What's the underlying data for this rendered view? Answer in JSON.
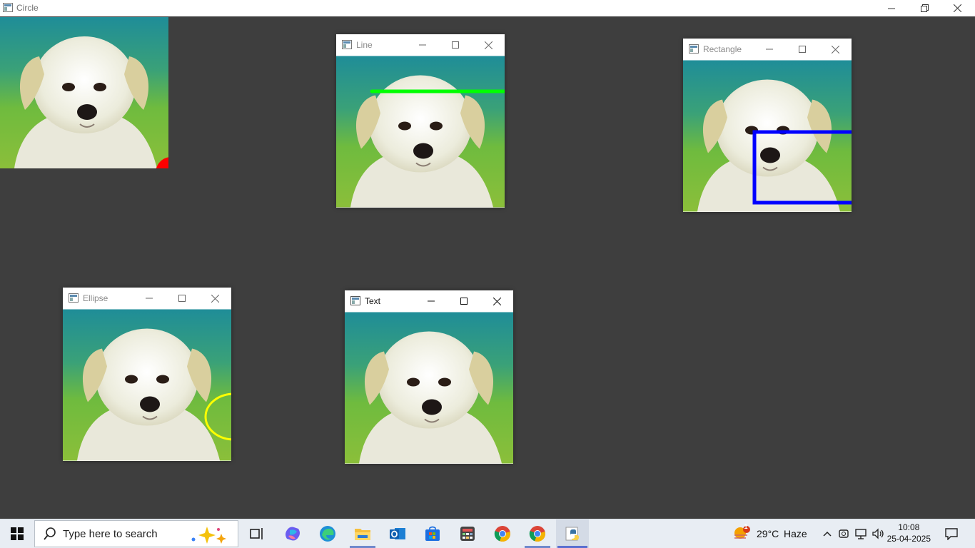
{
  "main_window": {
    "title": "Circle",
    "icon": "app-window-icon"
  },
  "windows": {
    "line": {
      "title": "Line"
    },
    "rectangle": {
      "title": "Rectangle"
    },
    "ellipse": {
      "title": "Ellipse"
    },
    "text": {
      "title": "Text"
    }
  },
  "taskbar": {
    "search_placeholder": "Type here to search",
    "weather_temp": "29°C",
    "weather_condition": "Haze",
    "weather_badge": "1",
    "time": "10:08",
    "date": "25-04-2025"
  },
  "colors": {
    "line": "#00ff00",
    "rectangle": "#0000ff",
    "ellipse": "#ffff00",
    "circle": "#ff0000",
    "taskbar_bg": "#e8edf3",
    "desktop_bg": "#3e3e3e"
  }
}
